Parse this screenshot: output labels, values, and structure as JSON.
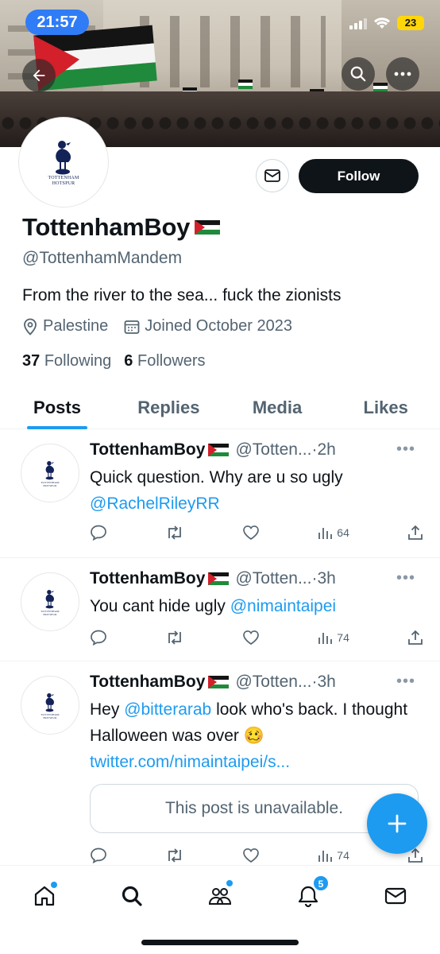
{
  "status_bar": {
    "time": "21:57",
    "battery": "23"
  },
  "profile": {
    "display_name": "TottenhamBoy",
    "handle": "@TottenhamMandem",
    "bio": "From the river to the sea... fuck the zionists",
    "location": "Palestine",
    "joined": "Joined October 2023",
    "following_count": "37",
    "following_label": "Following",
    "followers_count": "6",
    "followers_label": "Followers",
    "follow_label": "Follow",
    "avatar_text": [
      "TOTTENHAM",
      "HOTSPUR"
    ]
  },
  "tabs": [
    {
      "label": "Posts",
      "active": true
    },
    {
      "label": "Replies",
      "active": false
    },
    {
      "label": "Media",
      "active": false
    },
    {
      "label": "Likes",
      "active": false
    }
  ],
  "posts": [
    {
      "name": "TottenhamBoy",
      "handle": "@Totten...",
      "time": "·2h",
      "text": "Quick question. Why are u so ugly",
      "mention": "@RachelRileyRR",
      "views": "64"
    },
    {
      "name": "TottenhamBoy",
      "handle": "@Totten...",
      "time": "·3h",
      "text": "You cant hide ugly ",
      "mention": "@nimaintaipei",
      "views": "74"
    },
    {
      "name": "TottenhamBoy",
      "handle": "@Totten...",
      "time": "·3h",
      "text_before": "Hey ",
      "mention": "@bitterarab",
      "text_after": " look who's back. I thought Halloween was over 🥴",
      "link": "twitter.com/nimaintaipei/s...",
      "quoted": "This post is unavailable.",
      "views": "74"
    }
  ],
  "bottom_nav": {
    "notifications_badge": "5"
  },
  "colors": {
    "accent": "#1d9bf0",
    "text": "#0f1419",
    "muted": "#536471",
    "flag_red": "#d3202b",
    "flag_green": "#1f8a3b"
  }
}
